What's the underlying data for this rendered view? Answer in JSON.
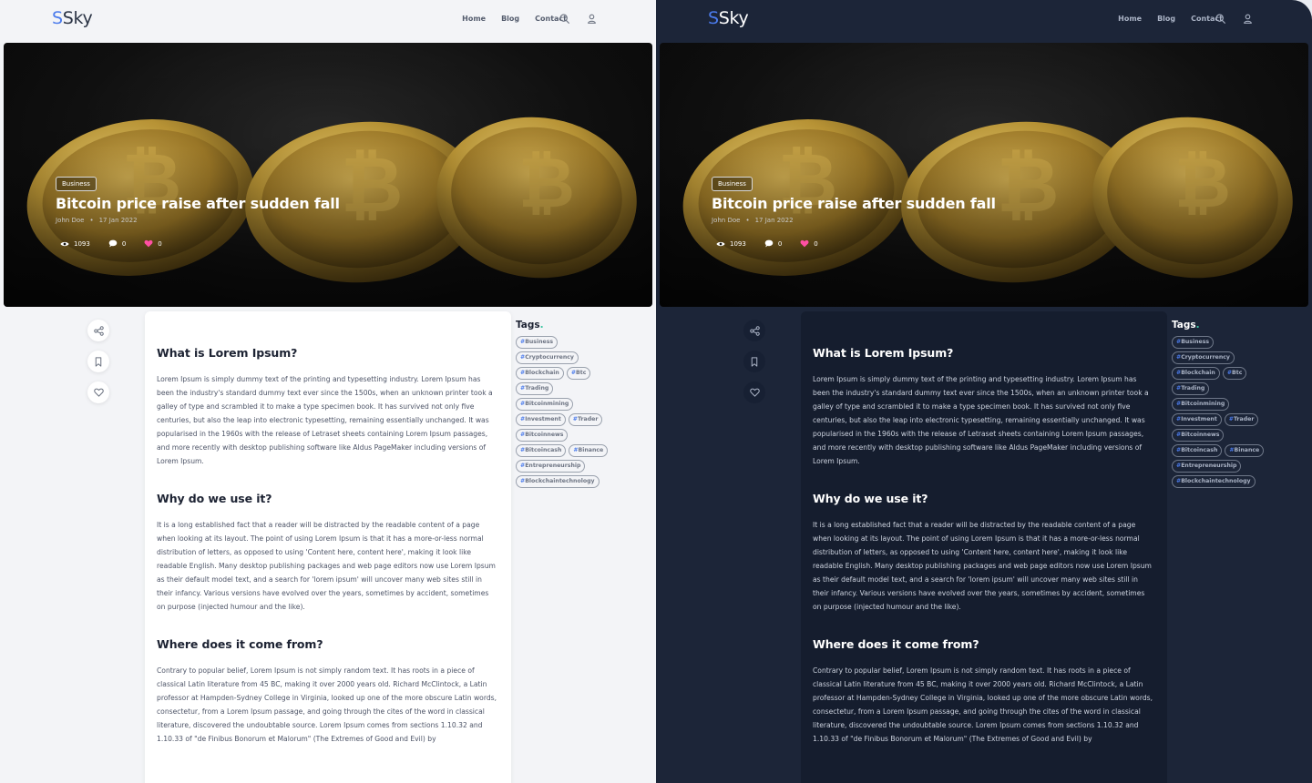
{
  "brand": {
    "logo_first": "S",
    "logo_rest": "Sky"
  },
  "nav": {
    "links": [
      "Home",
      "Blog",
      "Contact"
    ],
    "search_icon": "search-icon",
    "user_icon": "user-icon"
  },
  "hero": {
    "category": "Business",
    "title": "Bitcoin price raise after sudden fall",
    "author": "John Doe",
    "separator": "•",
    "date": "17 Jan 2022",
    "views": "1093",
    "comments": "0",
    "likes": "0"
  },
  "share_actions": [
    "share-icon",
    "bookmark-icon",
    "heart-icon"
  ],
  "article": {
    "sections": [
      {
        "heading": "What is Lorem Ipsum?",
        "body": "Lorem Ipsum is simply dummy text of the printing and typesetting industry. Lorem Ipsum has been the industry's standard dummy text ever since the 1500s, when an unknown printer took a galley of type and scrambled it to make a type specimen book. It has survived not only five centuries, but also the leap into electronic typesetting, remaining essentially unchanged. It was popularised in the 1960s with the release of Letraset sheets containing Lorem Ipsum passages, and more recently with desktop publishing software like Aldus PageMaker including versions of Lorem Ipsum."
      },
      {
        "heading": "Why do we use it?",
        "body": "It is a long established fact that a reader will be distracted by the readable content of a page when looking at its layout. The point of using Lorem Ipsum is that it has a more-or-less normal distribution of letters, as opposed to using 'Content here, content here', making it look like readable English. Many desktop publishing packages and web page editors now use Lorem Ipsum as their default model text, and a search for 'lorem ipsum' will uncover many web sites still in their infancy. Various versions have evolved over the years, sometimes by accident, sometimes on purpose (injected humour and the like)."
      },
      {
        "heading": "Where does it come from?",
        "body": "Contrary to popular belief, Lorem Ipsum is not simply random text. It has roots in a piece of classical Latin literature from 45 BC, making it over 2000 years old. Richard McClintock, a Latin professor at Hampden-Sydney College in Virginia, looked up one of the more obscure Latin words, consectetur, from a Lorem Ipsum passage, and going through the cites of the word in classical literature, discovered the undoubtable source. Lorem Ipsum comes from sections 1.10.32 and 1.10.33 of \"de Finibus Bonorum et Malorum\" (The Extremes of Good and Evil) by"
      }
    ]
  },
  "tags": {
    "title": "Tags",
    "dot": ".",
    "hash": "#",
    "items": [
      "Business",
      "Cryptocurrency",
      "Blockchain",
      "Btc",
      "Trading",
      "Bitcoinmining",
      "Investment",
      "Trader",
      "Bitcoinnews",
      "Bitcoincash",
      "Binance",
      "Entrepreneurship",
      "Blockchaintechnology"
    ]
  },
  "colors": {
    "accent": "#4b7bec",
    "light_bg": "#f3f4f7",
    "dark_bg": "#1c2538",
    "dark_card": "#151d2e",
    "heart": "#ff4fa3",
    "tag_dot": "#3cc7a3"
  },
  "themes": [
    "light",
    "dark"
  ]
}
